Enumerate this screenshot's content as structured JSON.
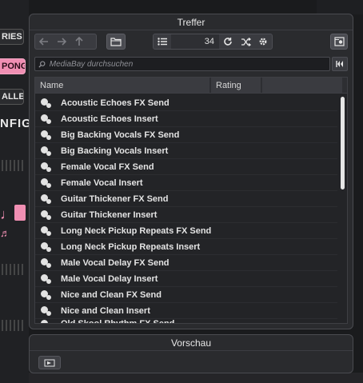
{
  "background": {
    "chips": [
      "RIES",
      "PONG",
      "ALLEL"
    ],
    "big_text": "NFIG"
  },
  "panel": {
    "title": "Treffer",
    "nav": {
      "back_icon": "arrow-left-icon",
      "forward_icon": "arrow-right-icon",
      "up_icon": "arrow-up-icon",
      "folder_icon": "folder-icon"
    },
    "result_count": "34",
    "count_icons": [
      "list-icon",
      "refresh-icon",
      "shuffle-icon",
      "settings-icon"
    ],
    "settings_icon": "panel-settings-icon",
    "search": {
      "placeholder": "MediaBay durchsuchen"
    },
    "columns": [
      "Name",
      "Rating",
      ""
    ],
    "rows": [
      "Acoustic Echoes FX Send",
      "Acoustic Echoes Insert",
      "Big Backing Vocals FX Send",
      "Big Backing Vocals Insert",
      "Female Vocal FX Send",
      "Female Vocal Insert",
      "Guitar Thickener FX Send",
      "Guitar Thickener Insert",
      "Long Neck Pickup Repeats FX Send",
      "Long Neck Pickup Repeats Insert",
      "Male Vocal Delay FX Send",
      "Male Vocal Delay Insert",
      "Nice and Clean FX Send",
      "Nice and Clean Insert",
      "Old Skool Rhythm FX Send"
    ]
  },
  "preview": {
    "title": "Vorschau"
  },
  "colors": {
    "panel_bg": "#2a2b2e",
    "accent_pink": "#f08fb3"
  }
}
